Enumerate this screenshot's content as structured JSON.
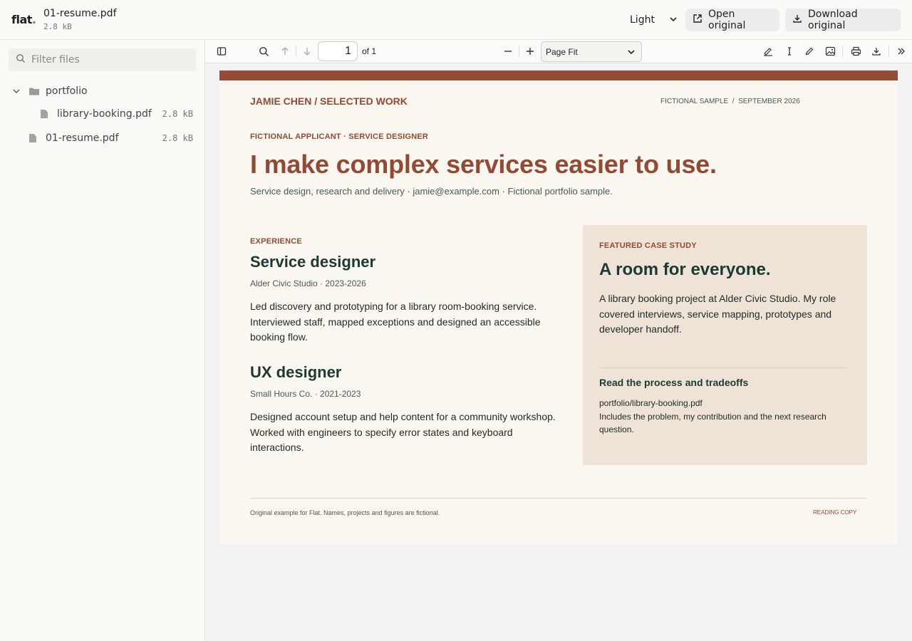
{
  "header": {
    "logo": "flat",
    "logo_dot": ".",
    "file_name": "01-resume.pdf",
    "file_size": "2.8 kB",
    "theme_value": "Light",
    "open_label": "Open original",
    "download_label": "Download original"
  },
  "sidebar": {
    "filter_placeholder": "Filter files",
    "folder": {
      "name": "portfolio",
      "expanded": true
    },
    "files": [
      {
        "name": "library-booking.pdf",
        "size": "2.8 kB"
      },
      {
        "name": "01-resume.pdf",
        "size": "2.8 kB"
      }
    ]
  },
  "viewer": {
    "page_number": "1",
    "page_of": "of 1",
    "zoom_value": "Page Fit"
  },
  "document": {
    "brand": "JAMIE CHEN / SELECTED WORK",
    "meta": "FICTIONAL SAMPLE  /  SEPTEMBER 2026",
    "kicker": "FICTIONAL APPLICANT · SERVICE DESIGNER",
    "headline": "I make complex services easier to use.",
    "subline": "Service design, research and delivery · jamie@example.com · Fictional portfolio sample.",
    "experience_label": "EXPERIENCE",
    "jobs": [
      {
        "title": "Service designer",
        "org": "Alder Civic Studio · 2023-2026",
        "desc": "Led discovery and prototyping for a library room-booking service. Interviewed staff, mapped exceptions and designed an accessible booking flow."
      },
      {
        "title": "UX designer",
        "org": "Small Hours Co. · 2021-2023",
        "desc": "Designed account setup and help content for a community workshop. Worked with engineers to specify error states and keyboard interactions."
      }
    ],
    "case": {
      "label": "FEATURED CASE STUDY",
      "title": "A room for everyone.",
      "desc": "A library booking project at Alder Civic Studio. My role covered interviews, service mapping, prototypes and developer handoff.",
      "link_title": "Read the process and tradeoffs",
      "link_path": "portfolio/library-booking.pdf",
      "link_desc": "Includes the problem, my contribution and the next research question."
    },
    "footer_note": "Original example for Flat. Names, projects and figures are fictional.",
    "footer_tag": "READING COPY"
  },
  "colors": {
    "accent_rust": "#924a35",
    "ink_green": "#1b3a33",
    "card_bg": "#efe2d6",
    "page_bg": "#faf6f0"
  }
}
